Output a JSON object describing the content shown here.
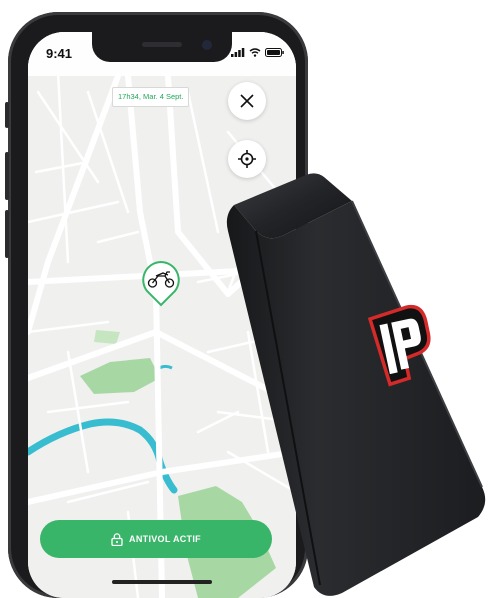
{
  "status_bar": {
    "time": "9:41"
  },
  "map": {
    "timestamp": "17h34, Mar. 4 Sept."
  },
  "controls": {
    "close_icon": "close-icon",
    "locate_icon": "crosshair-icon"
  },
  "marker": {
    "icon": "motorcycle-icon"
  },
  "antitheft": {
    "label": "ANTIVOL ACTIF",
    "icon": "lock-icon"
  },
  "colors": {
    "accent": "#39b56a",
    "water": "#37bcd0",
    "park": "#a7d8a4"
  }
}
